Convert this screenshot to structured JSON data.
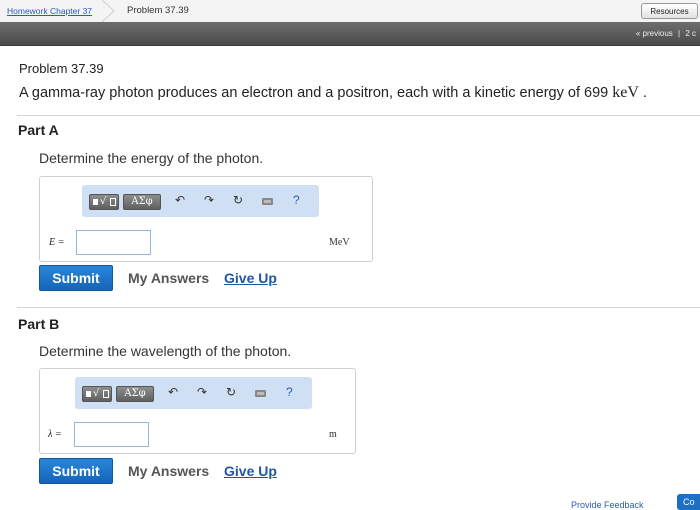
{
  "breadcrumb": {
    "assignment": "Homework Chapter 37",
    "problem": "Problem 37.39"
  },
  "header": {
    "resources_label": "Resources",
    "previous_label": "« previous",
    "separator": "|",
    "next_fragment": "2 c"
  },
  "problem": {
    "title": "Problem 37.39",
    "description_text": "A gamma-ray photon produces an electron and a positron, each with a kinetic energy of 699 ",
    "description_unit": "keV",
    "description_end": " ."
  },
  "toolbar": {
    "greek_label": "ΑΣφ",
    "help_label": "?"
  },
  "parts": [
    {
      "heading": "Part A",
      "question": "Determine the energy of the photon.",
      "variable": "E =",
      "input_value": "",
      "unit": "MeV"
    },
    {
      "heading": "Part B",
      "question": "Determine the wavelength of the photon.",
      "variable": "λ =",
      "input_value": "",
      "unit": "m"
    }
  ],
  "actions": {
    "submit": "Submit",
    "my_answers": "My Answers",
    "give_up": "Give Up"
  },
  "footer": {
    "feedback": "Provide Feedback",
    "continue_fragment": "Co"
  },
  "colors": {
    "accent": "#1b6fc4",
    "toolbar_bg": "#cfe0f4",
    "dark_bar": "#555555",
    "link": "#2a5db0"
  }
}
